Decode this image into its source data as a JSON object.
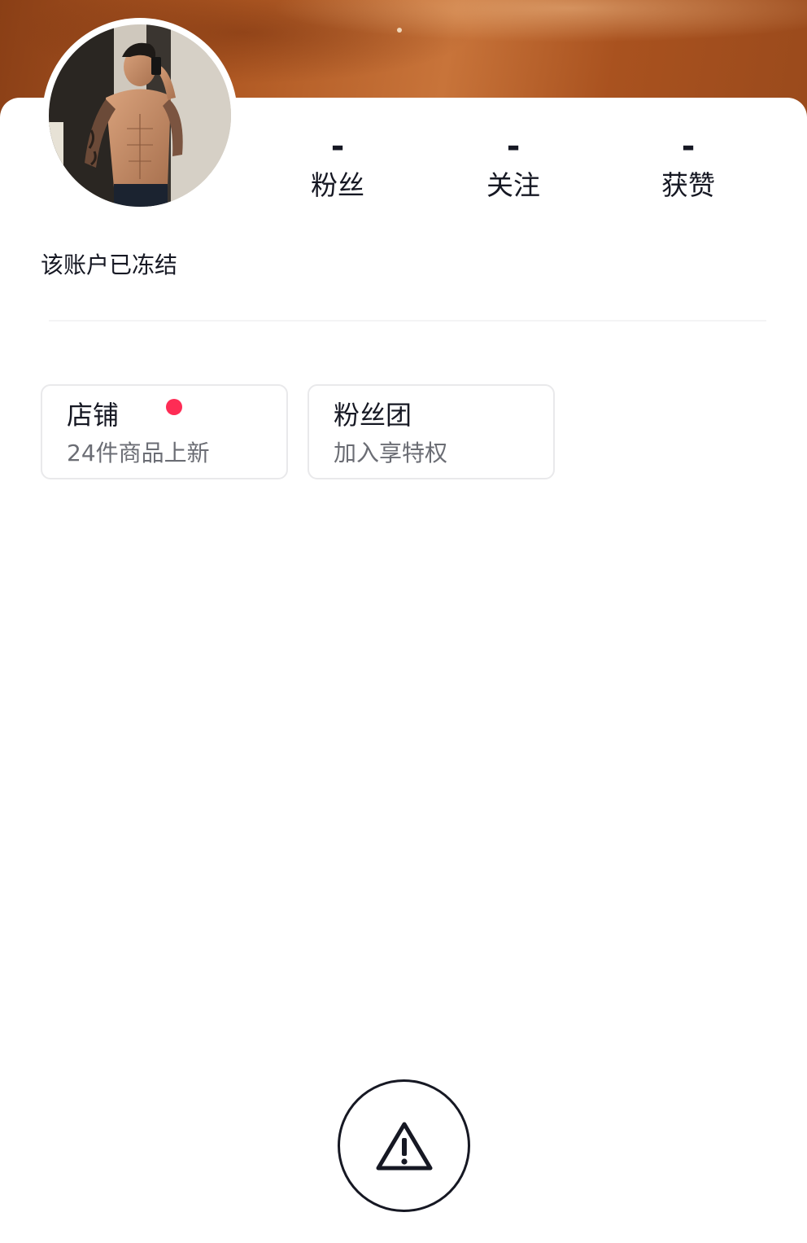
{
  "profile": {
    "status_text": "该账户已冻结",
    "avatar_icon": "user-avatar-photo"
  },
  "stats": [
    {
      "value": "-",
      "label": "粉丝"
    },
    {
      "value": "-",
      "label": "关注"
    },
    {
      "value": "-",
      "label": "获赞"
    }
  ],
  "cards": {
    "shop": {
      "title": "店铺",
      "subtitle": "24件商品上新",
      "has_badge": true
    },
    "fan_club": {
      "title": "粉丝团",
      "subtitle": "加入享特权"
    }
  },
  "warning": {
    "icon": "warning-triangle-icon"
  },
  "colors": {
    "badge": "#fe2c55",
    "text_primary": "#161823",
    "text_secondary": "#6b6d74",
    "cover": "#b15a24"
  }
}
